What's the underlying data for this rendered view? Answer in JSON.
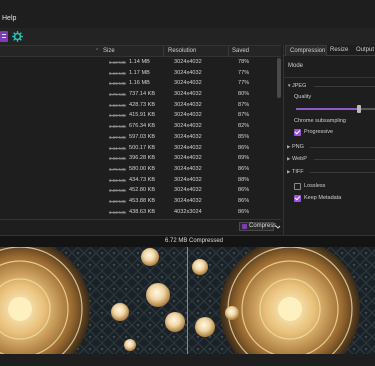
{
  "menu": {
    "help": "Help"
  },
  "toolbar": {
    "icons": [
      "compress-icon",
      "gear-icon"
    ],
    "accent": "#7b3fb5",
    "gear_color": "#28c4b9"
  },
  "table": {
    "columns": {
      "size": "Size",
      "resolution": "Resolution",
      "saved": "Saved"
    },
    "rows": [
      {
        "old": "5.18 MB",
        "new": "1.14 MB",
        "res": "3024x4032",
        "saved": "78%"
      },
      {
        "old": "5.16 MB",
        "new": "1.17 MB",
        "res": "3024x4032",
        "saved": "77%"
      },
      {
        "old": "5.03 MB",
        "new": "1.16 MB",
        "res": "3024x4032",
        "saved": "77%"
      },
      {
        "old": "3.79 MB",
        "new": "737.14 KB",
        "res": "3024x4032",
        "saved": "80%"
      },
      {
        "old": "3.53 MB",
        "new": "428.73 KB",
        "res": "3024x4032",
        "saved": "87%"
      },
      {
        "old": "3.28 MB",
        "new": "415.91 KB",
        "res": "3024x4032",
        "saved": "87%"
      },
      {
        "old": "3.89 MB",
        "new": "676.34 KB",
        "res": "3024x4032",
        "saved": "82%"
      },
      {
        "old": "3.87 MB",
        "new": "597.03 KB",
        "res": "3024x4032",
        "saved": "85%"
      },
      {
        "old": "3.61 MB",
        "new": "500.17 KB",
        "res": "3024x4032",
        "saved": "86%"
      },
      {
        "old": "3.55 MB",
        "new": "396.28 KB",
        "res": "3024x4032",
        "saved": "89%"
      },
      {
        "old": "3.79 MB",
        "new": "580.00 KB",
        "res": "3024x4032",
        "saved": "86%"
      },
      {
        "old": "3.51 MB",
        "new": "434.73 KB",
        "res": "3024x4032",
        "saved": "88%"
      },
      {
        "old": "3.20 MB",
        "new": "452.80 KB",
        "res": "3024x4032",
        "saved": "86%"
      },
      {
        "old": "3.20 MB",
        "new": "453.88 KB",
        "res": "3024x4032",
        "saved": "86%"
      },
      {
        "old": "3.13 MB",
        "new": "438.63 KB",
        "res": "4032x3024",
        "saved": "86%"
      }
    ]
  },
  "actions": {
    "compress": "Compress"
  },
  "panel": {
    "tabs": [
      "Compression",
      "Resize",
      "Output"
    ],
    "active_tab": "Compression",
    "mode_label": "Mode",
    "jpeg": {
      "header": "JPEG",
      "quality_label": "Quality",
      "quality_level": 0.79,
      "chroma_label": "Chrome subsampling",
      "progressive": {
        "label": "Progressive",
        "checked": true
      }
    },
    "sections": [
      "PNG",
      "WebP",
      "TIFF"
    ],
    "lossless": {
      "label": "Lossless",
      "checked": false
    },
    "keep_metadata": {
      "label": "Keep Metadata",
      "checked": true
    }
  },
  "preview": {
    "size": "6.72 MB",
    "label": "Compressed"
  },
  "colors": {
    "accent": "#9a56d6",
    "bg": "#1e1e1e",
    "gold": "#d8b070"
  }
}
